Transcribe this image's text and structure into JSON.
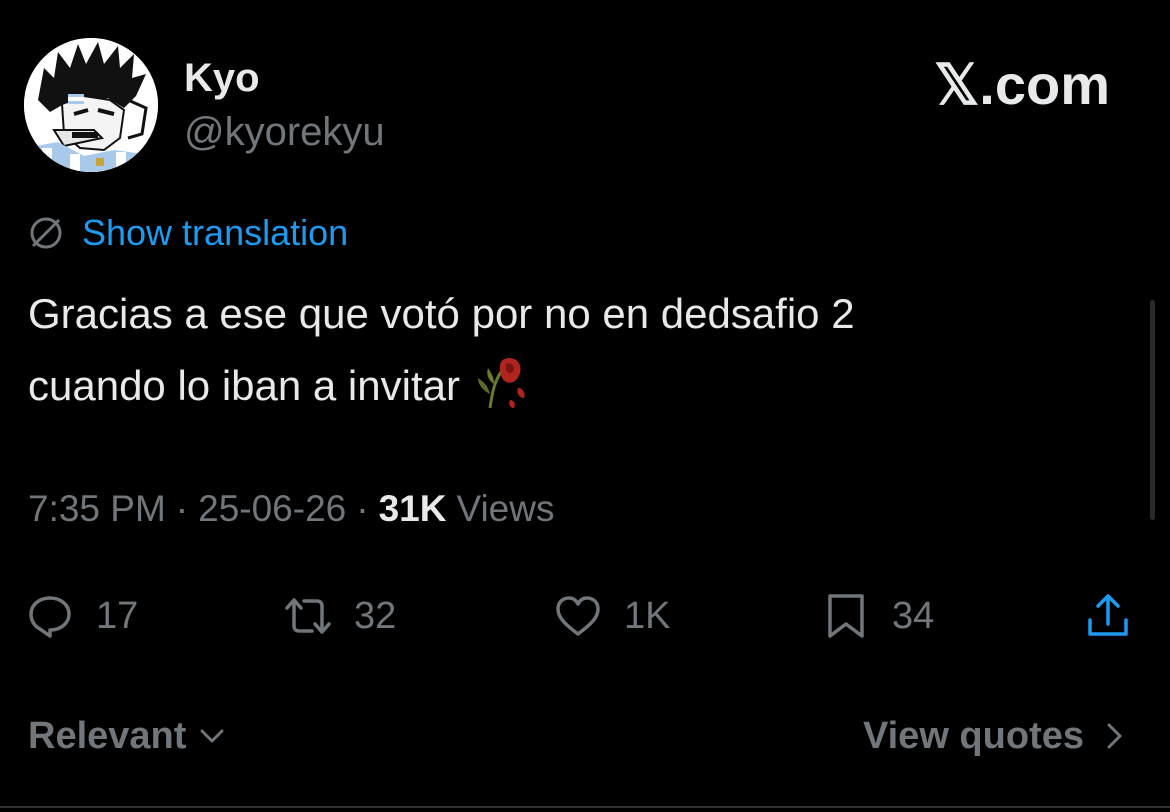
{
  "author": {
    "name": "Kyo",
    "handle": "@kyorekyu"
  },
  "brand": "𝕏.com",
  "translation_link": "Show translation",
  "tweet": {
    "line1": "Gracias a ese que votó por no en dedsafio 2",
    "line2": "cuando lo iban a invitar",
    "emoji": "wilted-rose"
  },
  "meta": {
    "time": "7:35 PM",
    "date": "25-06-26",
    "views_count": "31K",
    "views_label": "Views",
    "separator": "·"
  },
  "actions": {
    "replies": "17",
    "reposts": "32",
    "likes": "1K",
    "bookmarks": "34"
  },
  "footer": {
    "sort_label": "Relevant",
    "quotes_label": "View quotes"
  },
  "colors": {
    "background": "#000000",
    "text": "#e7e9ea",
    "muted": "#71767b",
    "link": "#1d9bf0"
  }
}
